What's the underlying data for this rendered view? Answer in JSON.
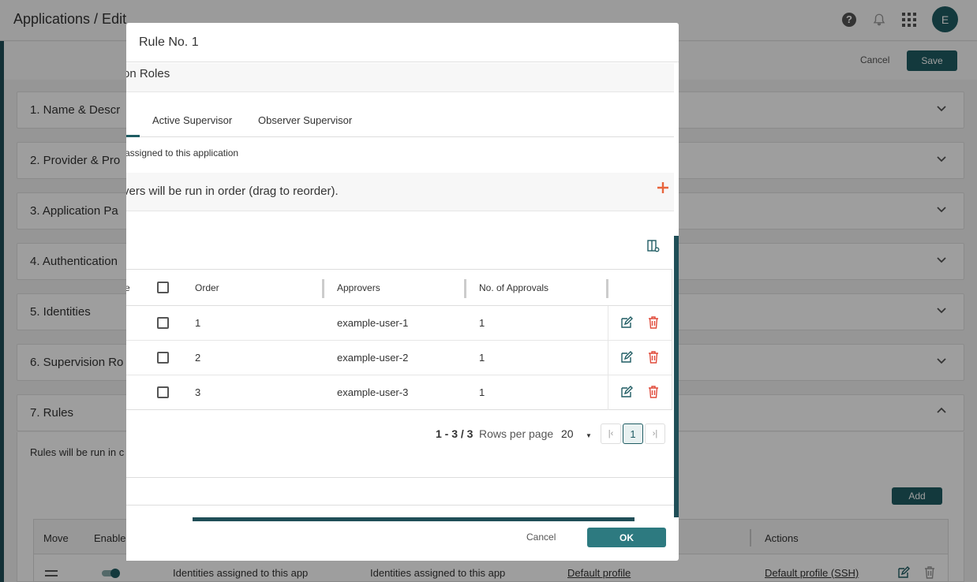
{
  "app": {
    "title": "Applications / Edit",
    "avatar_initial": "E",
    "cancel_label": "Cancel",
    "save_label": "Save"
  },
  "sections": [
    {
      "label": "1. Name & Descr"
    },
    {
      "label": "2. Provider & Pro"
    },
    {
      "label": "3. Application Pa"
    },
    {
      "label": "4. Authentication"
    },
    {
      "label": "5. Identities"
    },
    {
      "label": "6. Supervision Ro"
    },
    {
      "label": "7. Rules"
    }
  ],
  "rules": {
    "description": "Rules will be run in c",
    "add_label": "Add",
    "columns": [
      "Move",
      "Enablec",
      "Actions"
    ],
    "row": {
      "col1": "Identities assigned to this app",
      "col2": "Identities assigned to this app",
      "col3": "Default profile",
      "col4": "Default profile (SSH)"
    }
  },
  "modal": {
    "title": "Rule No. 1",
    "section_title": "on Roles",
    "tabs": [
      {
        "label": "Active Supervisor"
      },
      {
        "label": "Observer Supervisor"
      }
    ],
    "assigned_text": "assigned to this application",
    "approvers_text": "vers will be run in order (drag to reorder).",
    "table": {
      "partial_header": "e",
      "headers": [
        "Order",
        "Approvers",
        "No. of Approvals"
      ],
      "rows": [
        {
          "order": "1",
          "approver": "example-user-1",
          "approvals": "1"
        },
        {
          "order": "2",
          "approver": "example-user-2",
          "approvals": "1"
        },
        {
          "order": "3",
          "approver": "example-user-3",
          "approvals": "1"
        }
      ]
    },
    "pager": {
      "range": "1 - 3 / 3",
      "rows_per_page_label": "Rows per page",
      "rows_per_page_value": "20",
      "first_glyph": "|‹",
      "current_page": "1",
      "last_glyph": "›|"
    },
    "cancel_label": "Cancel",
    "ok_label": "OK"
  },
  "colors": {
    "accent": "#1f5c63",
    "danger": "#e04a3a",
    "plus": "#e8643c"
  }
}
